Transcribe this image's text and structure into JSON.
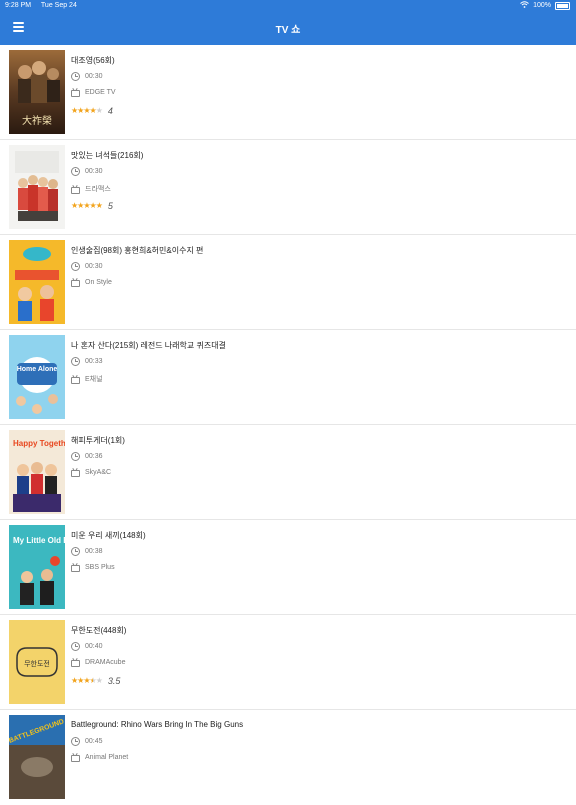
{
  "status_bar": {
    "time": "9:28 PM",
    "date": "Tue Sep 24",
    "battery": "100%"
  },
  "header": {
    "title": "TV 쇼",
    "menu_icon": "hamburger-menu-icon"
  },
  "colors": {
    "header_bg": "#2e7bd8",
    "star": "#f2a31b"
  },
  "shows": [
    {
      "title": "대조영(56회)",
      "duration": "00:30",
      "channel": "EDGE TV",
      "rating": "4",
      "stars": 4
    },
    {
      "title": "맛있는 녀석들(216회)",
      "duration": "00:30",
      "channel": "드라맥스",
      "rating": "5",
      "stars": 5
    },
    {
      "title": "인생술집(98회) 홍현희&허민&이수지 편",
      "duration": "00:30",
      "channel": "On Style",
      "rating": "",
      "stars": 0
    },
    {
      "title": "나 혼자 산다(215회) 레전드 나래학교 퀴즈대결",
      "duration": "00:33",
      "channel": "E채널",
      "rating": "",
      "stars": 0
    },
    {
      "title": "해피투게더(1회)",
      "duration": "00:36",
      "channel": "SkyA&C",
      "rating": "",
      "stars": 0
    },
    {
      "title": "미운 우리 새끼(148회)",
      "duration": "00:38",
      "channel": "SBS Plus",
      "rating": "",
      "stars": 0
    },
    {
      "title": "무한도전(448회)",
      "duration": "00:40",
      "channel": "DRAMAcube",
      "rating": "3.5",
      "stars": 3.5
    },
    {
      "title": "Battleground: Rhino Wars Bring In The Big Guns",
      "duration": "00:45",
      "channel": "Animal Planet",
      "rating": "",
      "stars": 0
    }
  ],
  "posters": [
    {
      "text": "大祚榮"
    },
    {
      "text": ""
    },
    {
      "text": ""
    },
    {
      "text": "Home Alone"
    },
    {
      "text": "Happy Together"
    },
    {
      "text": "My Little Old Boy"
    },
    {
      "text": "무한도전"
    },
    {
      "text": "BATTLEGROUND"
    }
  ]
}
